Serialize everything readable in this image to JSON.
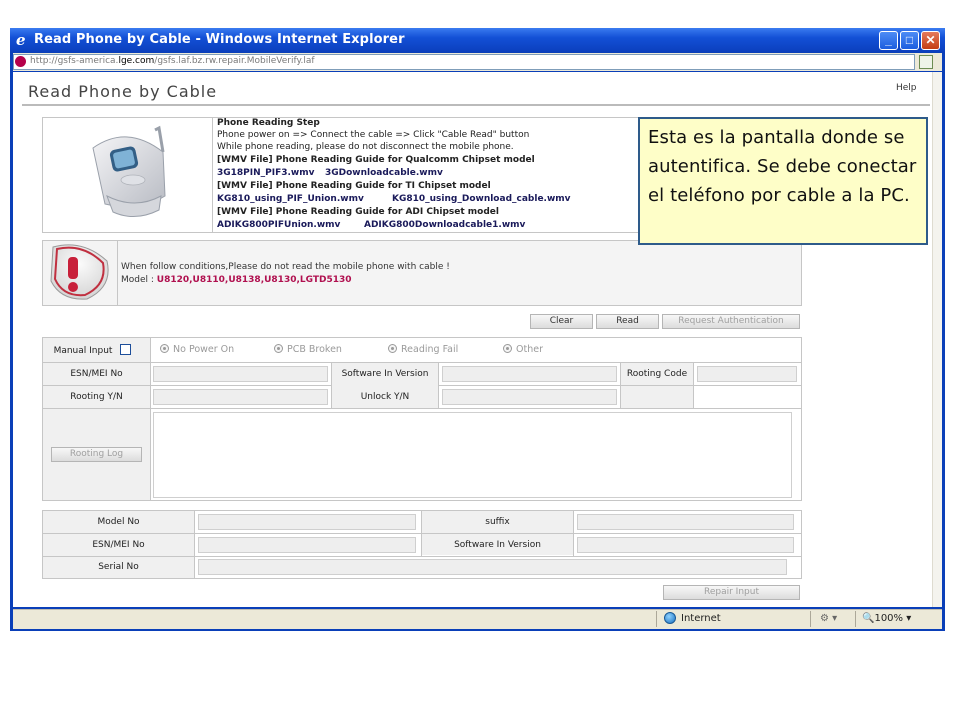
{
  "window": {
    "title": "Read Phone by Cable - Windows Internet Explorer",
    "url_prefix": "http://gsfs-america.",
    "url_domain": "lge.com",
    "url_suffix": "/gsfs.laf.bz.rw.repair.MobileVerify.laf"
  },
  "page": {
    "title": "Read Phone by Cable",
    "help": "Help"
  },
  "reading_step": {
    "heading": "Phone Reading Step",
    "lines": [
      "Phone power on => Connect the cable => Click \"Cable Read\" button",
      "While phone reading, please do not disconnect the mobile phone."
    ],
    "guides": [
      {
        "title": "[WMV File] Phone Reading Guide for Qualcomm Chipset model",
        "file1": "3G18PIN_PIF3.wmv",
        "file2": "3GDownloadcable.wmv"
      },
      {
        "title": "[WMV File] Phone Reading Guide for TI Chipset model",
        "file1": "KG810_using_PIF_Union.wmv",
        "file2": "KG810_using_Download_cable.wmv"
      },
      {
        "title": "[WMV File] Phone Reading Guide for ADI Chipset model",
        "file1": "ADIKG800PIFUnion.wmv",
        "file2": "ADIKG800Downloadcable1.wmv"
      }
    ]
  },
  "warning": {
    "text": "When follow conditions,Please do not read the mobile phone with cable !",
    "model_label": "Model : ",
    "models": "U8120,U8110,U8138,U8130,LGTD5130"
  },
  "actions": {
    "clear": "Clear",
    "read": "Read",
    "request_auth": "Request Authentication"
  },
  "form": {
    "manual_input": "Manual Input",
    "radios": [
      "No Power On",
      "PCB Broken",
      "Reading Fail",
      "Other"
    ],
    "esn_label": "ESN/MEI No",
    "sw_version_label": "Software In Version",
    "rooting_code_label": "Rooting Code",
    "rooting_yn_label": "Rooting Y/N",
    "unlock_yn_label": "Unlock Y/N",
    "rooting_log_button": "Rooting Log"
  },
  "result": {
    "model_label": "Model No",
    "suffix_label": "suffix",
    "esn_label": "ESN/MEI No",
    "sw_version_label": "Software In Version",
    "serial_label": "Serial No",
    "repair_input": "Repair Input"
  },
  "statusbar": {
    "zone": "Internet",
    "zoom": "100%"
  },
  "annotation": {
    "text": "Esta es la pantalla donde se autentifica. Se debe conectar el teléfono por cable a la PC."
  },
  "colors": {
    "titlebar": "#1350d6",
    "warning_models": "#b0104f",
    "callout_bg": "#fefec8",
    "callout_border": "#2e5b8a"
  }
}
